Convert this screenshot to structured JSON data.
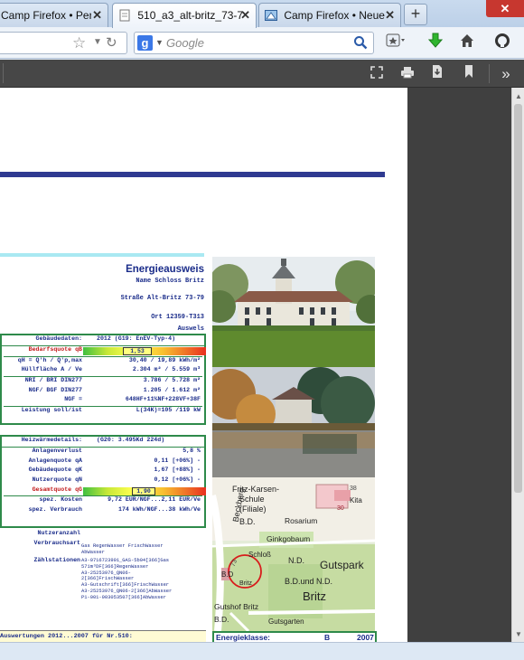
{
  "browser": {
    "tabs": [
      {
        "title": "Camp Firefox • Pers...",
        "active": false
      },
      {
        "title": "510_a3_alt-britz_73-7...",
        "active": true
      },
      {
        "title": "Camp Firefox • Neue...",
        "active": false
      }
    ],
    "new_tab_label": "+",
    "window_close_label": "✕",
    "search_placeholder": "Google",
    "search_engine_badge": "g"
  },
  "document": {
    "title": "Energieausweis",
    "header": {
      "name": "Name Schloss Britz",
      "strasse": "Straße Alt-Britz 73-79",
      "ort": "Ort 12359-T313",
      "ausweis": "Auswels"
    },
    "gebaeude": {
      "head_label": "Gebäudedaten:",
      "head_value": "2012 (G19: EnEV-Typ-4)",
      "bedarf_label": "Bedarfsquote qB",
      "bedarf_value": "1,53",
      "bedarf_fraction": 0.32,
      "rows": [
        {
          "label": "qH = Q'h / Q'p,max",
          "value": "30,40 / 19,89 kWh/m²"
        },
        {
          "label": "Hüllfläche A / Ve",
          "value": "2.304 m² / 5.559 m³"
        },
        {
          "label": "NRI / BRI DIN277",
          "value": "3.786 / 5.728 m²"
        },
        {
          "label": "NGF/ BGF DIN277",
          "value": "1.205 / 1.612 m²"
        },
        {
          "label": "NGF =",
          "value": "648HF+11%NF+228VF+38F"
        },
        {
          "label": "Leistung soll/ist",
          "value": "L(34K)=105 /119 kW"
        }
      ]
    },
    "waerme": {
      "head_label": "Heizwärmedetails:",
      "head_value": "(G20: 3.495Kd 224d)",
      "rows": [
        {
          "label": "Anlagenverlust",
          "value": "5,8 %"
        },
        {
          "label": "Anlagenquote qA",
          "value": "0,11 [+06%] -"
        },
        {
          "label": "Gebäudequote qK",
          "value": "1,67 [+88%] -"
        },
        {
          "label": "Nutzerquote qN",
          "value": "0,12 [+06%] -"
        }
      ],
      "gesamt_label": "Gesamtquote qG",
      "gesamt_value": "1,90",
      "gesamt_fraction": 0.4,
      "kosten_label": "spez. Kosten",
      "kosten_value": "9,72 EUR/NGF...2,11 EUR/Ve",
      "verbrauch_label": "spez. Verbrauch",
      "verbrauch_value": "174 kWh/NGF...38 kWh/Ve"
    },
    "nutzer": {
      "nutzeranzahl_label": "Nutzeranzahl",
      "verbrauchsart_label": "Verbrauchsart",
      "verbrauchsart_value": "Gas RegenWasser FrischWasser",
      "verbrauchsart_value2": "AbWasser",
      "zaehl_label": "Zählstationen",
      "zaehl_lines": [
        "A3-0716723901_GAS-5b04[366]Gas",
        "571m³DF[366]RegenWasser",
        "A3-25253976_QN06-",
        "2[366]FrischWasser",
        "A3-Gutschrift[366]FrischWasser",
        "A3-25253976_QN06-2[366]AbWasser",
        "P1-001-003053507[366]AbWasser"
      ]
    },
    "auswertung": "Auswertungen 2012...2007 für Nr.510:",
    "energieklasse_label": "Energieklasse:",
    "energieklasse_value": "B",
    "energieklasse_year": "2007",
    "map_labels": {
      "beckberg": "Beckberg",
      "fritz_karsen": "Fritz-Karsen-",
      "schule": "Schule",
      "filiale": "(Filiale)",
      "bd1": "B.D.",
      "rosarium": "Rosarium",
      "ginkgobaum": "Ginkgobaum",
      "schloss": "Schloß",
      "nd1": "N.D.",
      "gutspark": "Gutspark",
      "bd_nd": "B.D.und N.D.",
      "britz": "Britz",
      "britz_small": "Britz",
      "bd2": "B.D",
      "gutshof": "Gutshof Britz",
      "gutsgarten": "Gutsgarten",
      "kita": "Kita",
      "bd3": "B.D.",
      "n30": "30",
      "n73": "73",
      "n38": "38"
    }
  },
  "colors": {
    "heading": "#1a2c8a",
    "section_border": "#2e8a4a",
    "top_rule": "#2f3a91",
    "accent_rule": "#a9e9f2"
  }
}
